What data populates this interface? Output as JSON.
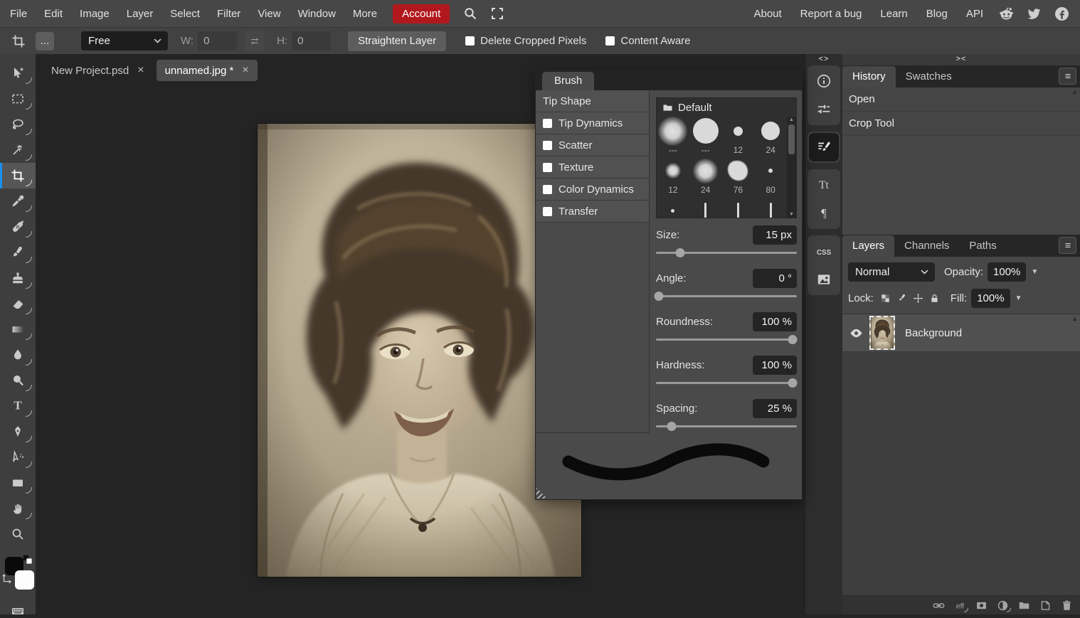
{
  "menubar": {
    "items": [
      "File",
      "Edit",
      "Image",
      "Layer",
      "Select",
      "Filter",
      "View",
      "Window",
      "More"
    ],
    "account_label": "Account",
    "links": [
      "About",
      "Report a bug",
      "Learn",
      "Blog",
      "API"
    ]
  },
  "optionsbar": {
    "more_label": "...",
    "aspect_value": "Free",
    "width_label": "W:",
    "width_value": "0",
    "height_label": "H:",
    "height_value": "0",
    "straighten_label": "Straighten Layer",
    "checkboxes": [
      {
        "label": "Delete Cropped Pixels",
        "checked": false
      },
      {
        "label": "Content Aware",
        "checked": false
      }
    ]
  },
  "tabs": [
    {
      "label": "New Project.psd",
      "active": false
    },
    {
      "label": "unnamed.jpg *",
      "active": true
    }
  ],
  "toolbar": {
    "tools": [
      {
        "name": "move-tool",
        "subtools": true,
        "active": false
      },
      {
        "name": "select-tool",
        "subtools": true,
        "active": false
      },
      {
        "name": "lasso-tool",
        "subtools": true,
        "active": false
      },
      {
        "name": "magic-wand-tool",
        "subtools": true,
        "active": false
      },
      {
        "name": "crop-tool",
        "subtools": true,
        "active": true
      },
      {
        "name": "eyedropper-tool",
        "subtools": true,
        "active": false
      },
      {
        "name": "healing-tool",
        "subtools": true,
        "active": false
      },
      {
        "name": "brush-tool",
        "subtools": true,
        "active": false
      },
      {
        "name": "clone-stamp-tool",
        "subtools": true,
        "active": false
      },
      {
        "name": "eraser-tool",
        "subtools": true,
        "active": false
      },
      {
        "name": "gradient-tool",
        "subtools": true,
        "active": false
      },
      {
        "name": "blur-tool",
        "subtools": true,
        "active": false
      },
      {
        "name": "dodge-tool",
        "subtools": true,
        "active": false
      },
      {
        "name": "type-tool",
        "subtools": true,
        "active": false
      },
      {
        "name": "pen-tool",
        "subtools": true,
        "active": false
      },
      {
        "name": "path-select-tool",
        "subtools": true,
        "active": false
      },
      {
        "name": "shape-tool",
        "subtools": true,
        "active": false
      },
      {
        "name": "hand-tool",
        "subtools": true,
        "active": false
      },
      {
        "name": "zoom-tool",
        "subtools": false,
        "active": false
      }
    ]
  },
  "brush_panel": {
    "title": "Brush",
    "sections": [
      {
        "label": "Tip Shape",
        "has_checkbox": false,
        "checked": false
      },
      {
        "label": "Tip Dynamics",
        "has_checkbox": true,
        "checked": false
      },
      {
        "label": "Scatter",
        "has_checkbox": true,
        "checked": false
      },
      {
        "label": "Texture",
        "has_checkbox": true,
        "checked": false
      },
      {
        "label": "Color Dynamics",
        "has_checkbox": true,
        "checked": false
      },
      {
        "label": "Transfer",
        "has_checkbox": true,
        "checked": false
      }
    ],
    "presets": {
      "folder_label": "Default",
      "items": [
        {
          "label": "---",
          "shape": "soft",
          "size": 30
        },
        {
          "label": "---",
          "shape": "hard",
          "size": 36
        },
        {
          "label": "12",
          "shape": "hard",
          "size": 13
        },
        {
          "label": "24",
          "shape": "hard",
          "size": 26
        },
        {
          "label": "12",
          "shape": "soft",
          "size": 16
        },
        {
          "label": "24",
          "shape": "soft",
          "size": 26
        },
        {
          "label": "76",
          "shape": "splat",
          "size": 28
        },
        {
          "label": "80",
          "shape": "hard",
          "size": 6
        },
        {
          "label": "",
          "shape": "hard",
          "size": 5
        },
        {
          "label": "",
          "shape": "line",
          "size": 22
        },
        {
          "label": "",
          "shape": "line",
          "size": 22
        },
        {
          "label": "",
          "shape": "line",
          "size": 22
        }
      ]
    },
    "sliders": [
      {
        "label": "Size:",
        "value": "15",
        "unit": "px",
        "pos": 17
      },
      {
        "label": "Angle:",
        "value": "0",
        "unit": "°",
        "pos": 2
      },
      {
        "label": "Roundness:",
        "value": "100",
        "unit": "%",
        "pos": 97
      },
      {
        "label": "Hardness:",
        "value": "100",
        "unit": "%",
        "pos": 97
      },
      {
        "label": "Spacing:",
        "value": "25",
        "unit": "%",
        "pos": 11
      }
    ]
  },
  "right_strip": {
    "collapse_label": "<>",
    "labels": {
      "glyphs": "Tt",
      "paragraph": "¶",
      "css": "CSS"
    },
    "groups": [
      {
        "icons": [
          "info-icon",
          "adjustments-icon"
        ],
        "active": false
      },
      {
        "icons": [
          "brush-settings-icon"
        ],
        "active": true
      },
      {
        "icons": [
          "glyphs-icon",
          "paragraph-icon"
        ],
        "active": false
      },
      {
        "icons": [
          "css-icon",
          "image-icon"
        ],
        "active": false
      }
    ]
  },
  "history_panel": {
    "collapse_label": "><",
    "tabs": [
      {
        "label": "History",
        "active": true
      },
      {
        "label": "Swatches",
        "active": false
      }
    ],
    "items": [
      "Open",
      "Crop Tool"
    ]
  },
  "layers_panel": {
    "tabs": [
      {
        "label": "Layers",
        "active": true
      },
      {
        "label": "Channels",
        "active": false
      },
      {
        "label": "Paths",
        "active": false
      }
    ],
    "blend_mode": "Normal",
    "opacity_label": "Opacity:",
    "opacity_value": "100%",
    "lock_label": "Lock:",
    "lock_icons": [
      "lock-transparency-icon",
      "lock-paint-icon",
      "lock-move-icon",
      "lock-all-icon"
    ],
    "fill_label": "Fill:",
    "fill_value": "100%",
    "effects_label": "eff",
    "layers": [
      {
        "name": "Background",
        "visible": true,
        "selected": true
      }
    ],
    "bottom_icons": [
      "link-icon",
      "effects-icon",
      "mask-icon",
      "adjustment-icon",
      "group-icon",
      "new-layer-icon",
      "delete-icon"
    ]
  },
  "colors": {
    "accent_blue": "#1c8ff0",
    "account_red": "#b1181d"
  }
}
